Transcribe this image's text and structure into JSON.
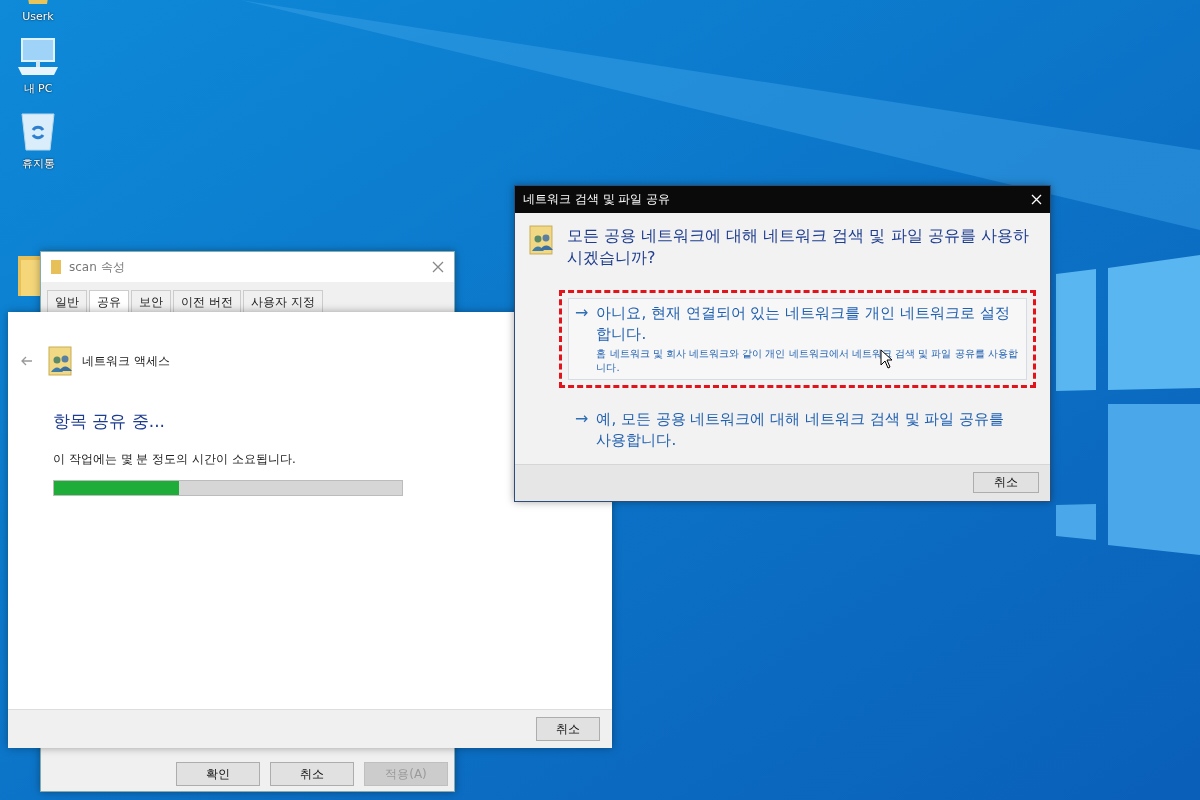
{
  "desktop_icons": [
    {
      "label": "Userk",
      "kind": "user"
    },
    {
      "label": "내 PC",
      "kind": "pc"
    },
    {
      "label": "휴지통",
      "kind": "bin"
    }
  ],
  "properties_window": {
    "title": "scan 속성",
    "tabs": [
      {
        "label": "일반",
        "selected": false
      },
      {
        "label": "공유",
        "selected": true
      },
      {
        "label": "보안",
        "selected": false
      },
      {
        "label": "이전 버전",
        "selected": false
      },
      {
        "label": "사용자 지정",
        "selected": false
      }
    ],
    "buttons": [
      {
        "label": "확인",
        "disabled": false
      },
      {
        "label": "취소",
        "disabled": false
      },
      {
        "label": "적용(A)",
        "disabled": true
      }
    ]
  },
  "wizard": {
    "title": "네트워크 액세스",
    "heading": "항목 공유 중...",
    "message": "이 작업에는 몇 분 정도의 시간이 소요됩니다.",
    "progress": {
      "level": 0.36
    },
    "buttons": [
      "취소"
    ]
  },
  "dialog": {
    "title": "네트워크 검색 및 파일 공유",
    "question": "모든 공용 네트워크에 대해 네트워크 검색 및 파일 공유를 사용하시겠습니까?",
    "options": [
      {
        "arrow": "→",
        "label": "아니요, 현재 연결되어 있는 네트워크를 개인 네트워크로 설정합니다.",
        "description": "홈 네트워크 및 회사 네트워크와 같이 개인 네트워크에서 네트워크 검색 및 파일 공유를 사용합니다.",
        "hovered": true,
        "marked": true
      },
      {
        "arrow": "→",
        "label": "예, 모든 공용 네트워크에 대해 네트워크 검색 및 파일 공유를 사용합니다.",
        "hovered": false,
        "marked": false
      }
    ],
    "buttons": [
      "취소"
    ]
  }
}
